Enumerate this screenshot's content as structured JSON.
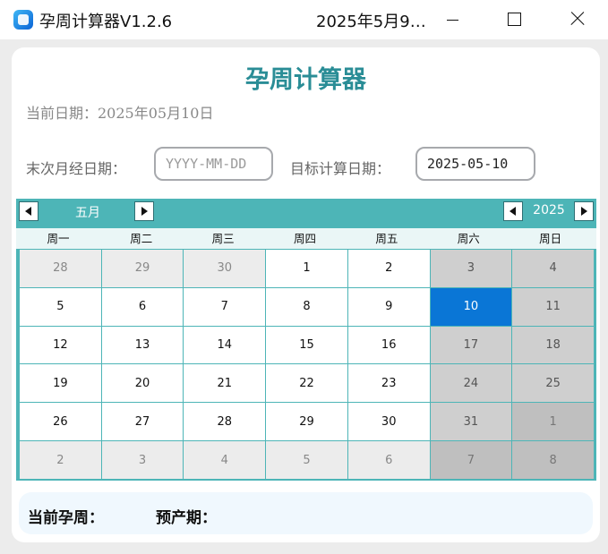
{
  "window": {
    "app_title": "孕周计算器V1.2.6",
    "title_text": "2025年5月9…"
  },
  "main": {
    "title": "孕周计算器",
    "current_date": "当前日期：2025年05月10日",
    "last_period_label": "末次月经日期：",
    "last_period_placeholder": "YYYY-MM-DD",
    "last_period_value": "",
    "target_date_label": "目标计算日期：",
    "target_date_value": "2025-05-10"
  },
  "calendar": {
    "month_label": "五月",
    "year_label": "2025",
    "weekdays": [
      "周一",
      "周二",
      "周三",
      "周四",
      "周五",
      "周六",
      "周日"
    ],
    "selected_day": "10",
    "weeks": [
      [
        "28",
        "29",
        "30",
        "1",
        "2",
        "3",
        "4"
      ],
      [
        "5",
        "6",
        "7",
        "8",
        "9",
        "10",
        "11"
      ],
      [
        "12",
        "13",
        "14",
        "15",
        "16",
        "17",
        "18"
      ],
      [
        "19",
        "20",
        "21",
        "22",
        "23",
        "24",
        "25"
      ],
      [
        "26",
        "27",
        "28",
        "29",
        "30",
        "31",
        "1"
      ],
      [
        "2",
        "3",
        "4",
        "5",
        "6",
        "7",
        "8"
      ]
    ]
  },
  "result": {
    "week_label": "当前孕周：",
    "due_label": "预产期："
  },
  "colors": {
    "accent": "#2a8d96",
    "calendar_header": "#4db5b7",
    "selected": "#0a76d6"
  }
}
